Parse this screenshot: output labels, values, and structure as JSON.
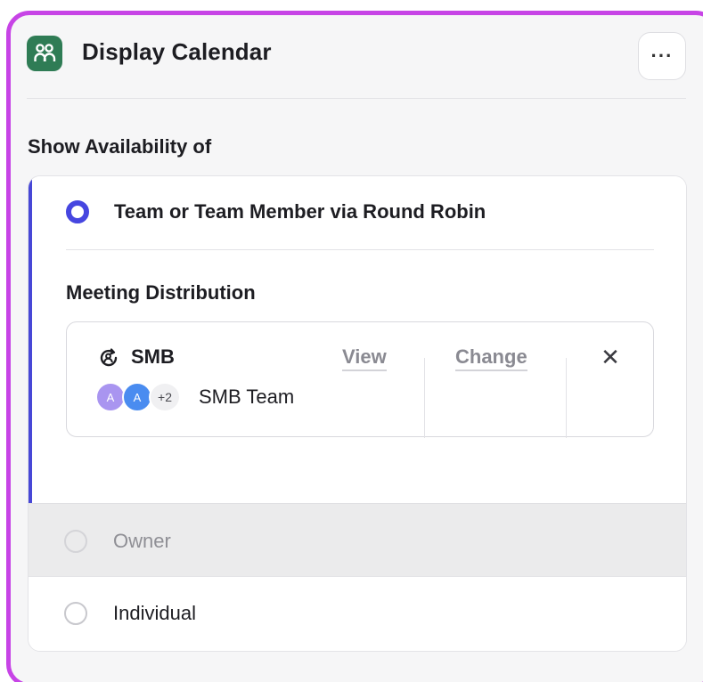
{
  "header": {
    "title": "Display Calendar",
    "more_label": "···",
    "icon": "people-icon",
    "icon_bg": "#2f7c55"
  },
  "availability": {
    "label": "Show Availability of",
    "options": [
      {
        "label": "Team or Team Member via Round Robin",
        "selected": true
      },
      {
        "label": "Owner",
        "selected": false,
        "disabled": true
      },
      {
        "label": "Individual",
        "selected": false
      }
    ]
  },
  "distribution": {
    "label": "Meeting Distribution",
    "group_name": "SMB",
    "team_name": "SMB Team",
    "avatars": [
      "A",
      "A"
    ],
    "avatar_more": "+2",
    "view_label": "View",
    "change_label": "Change",
    "remove_label": "✕"
  },
  "colors": {
    "accent": "#4646e0",
    "frame": "#c744e6"
  }
}
